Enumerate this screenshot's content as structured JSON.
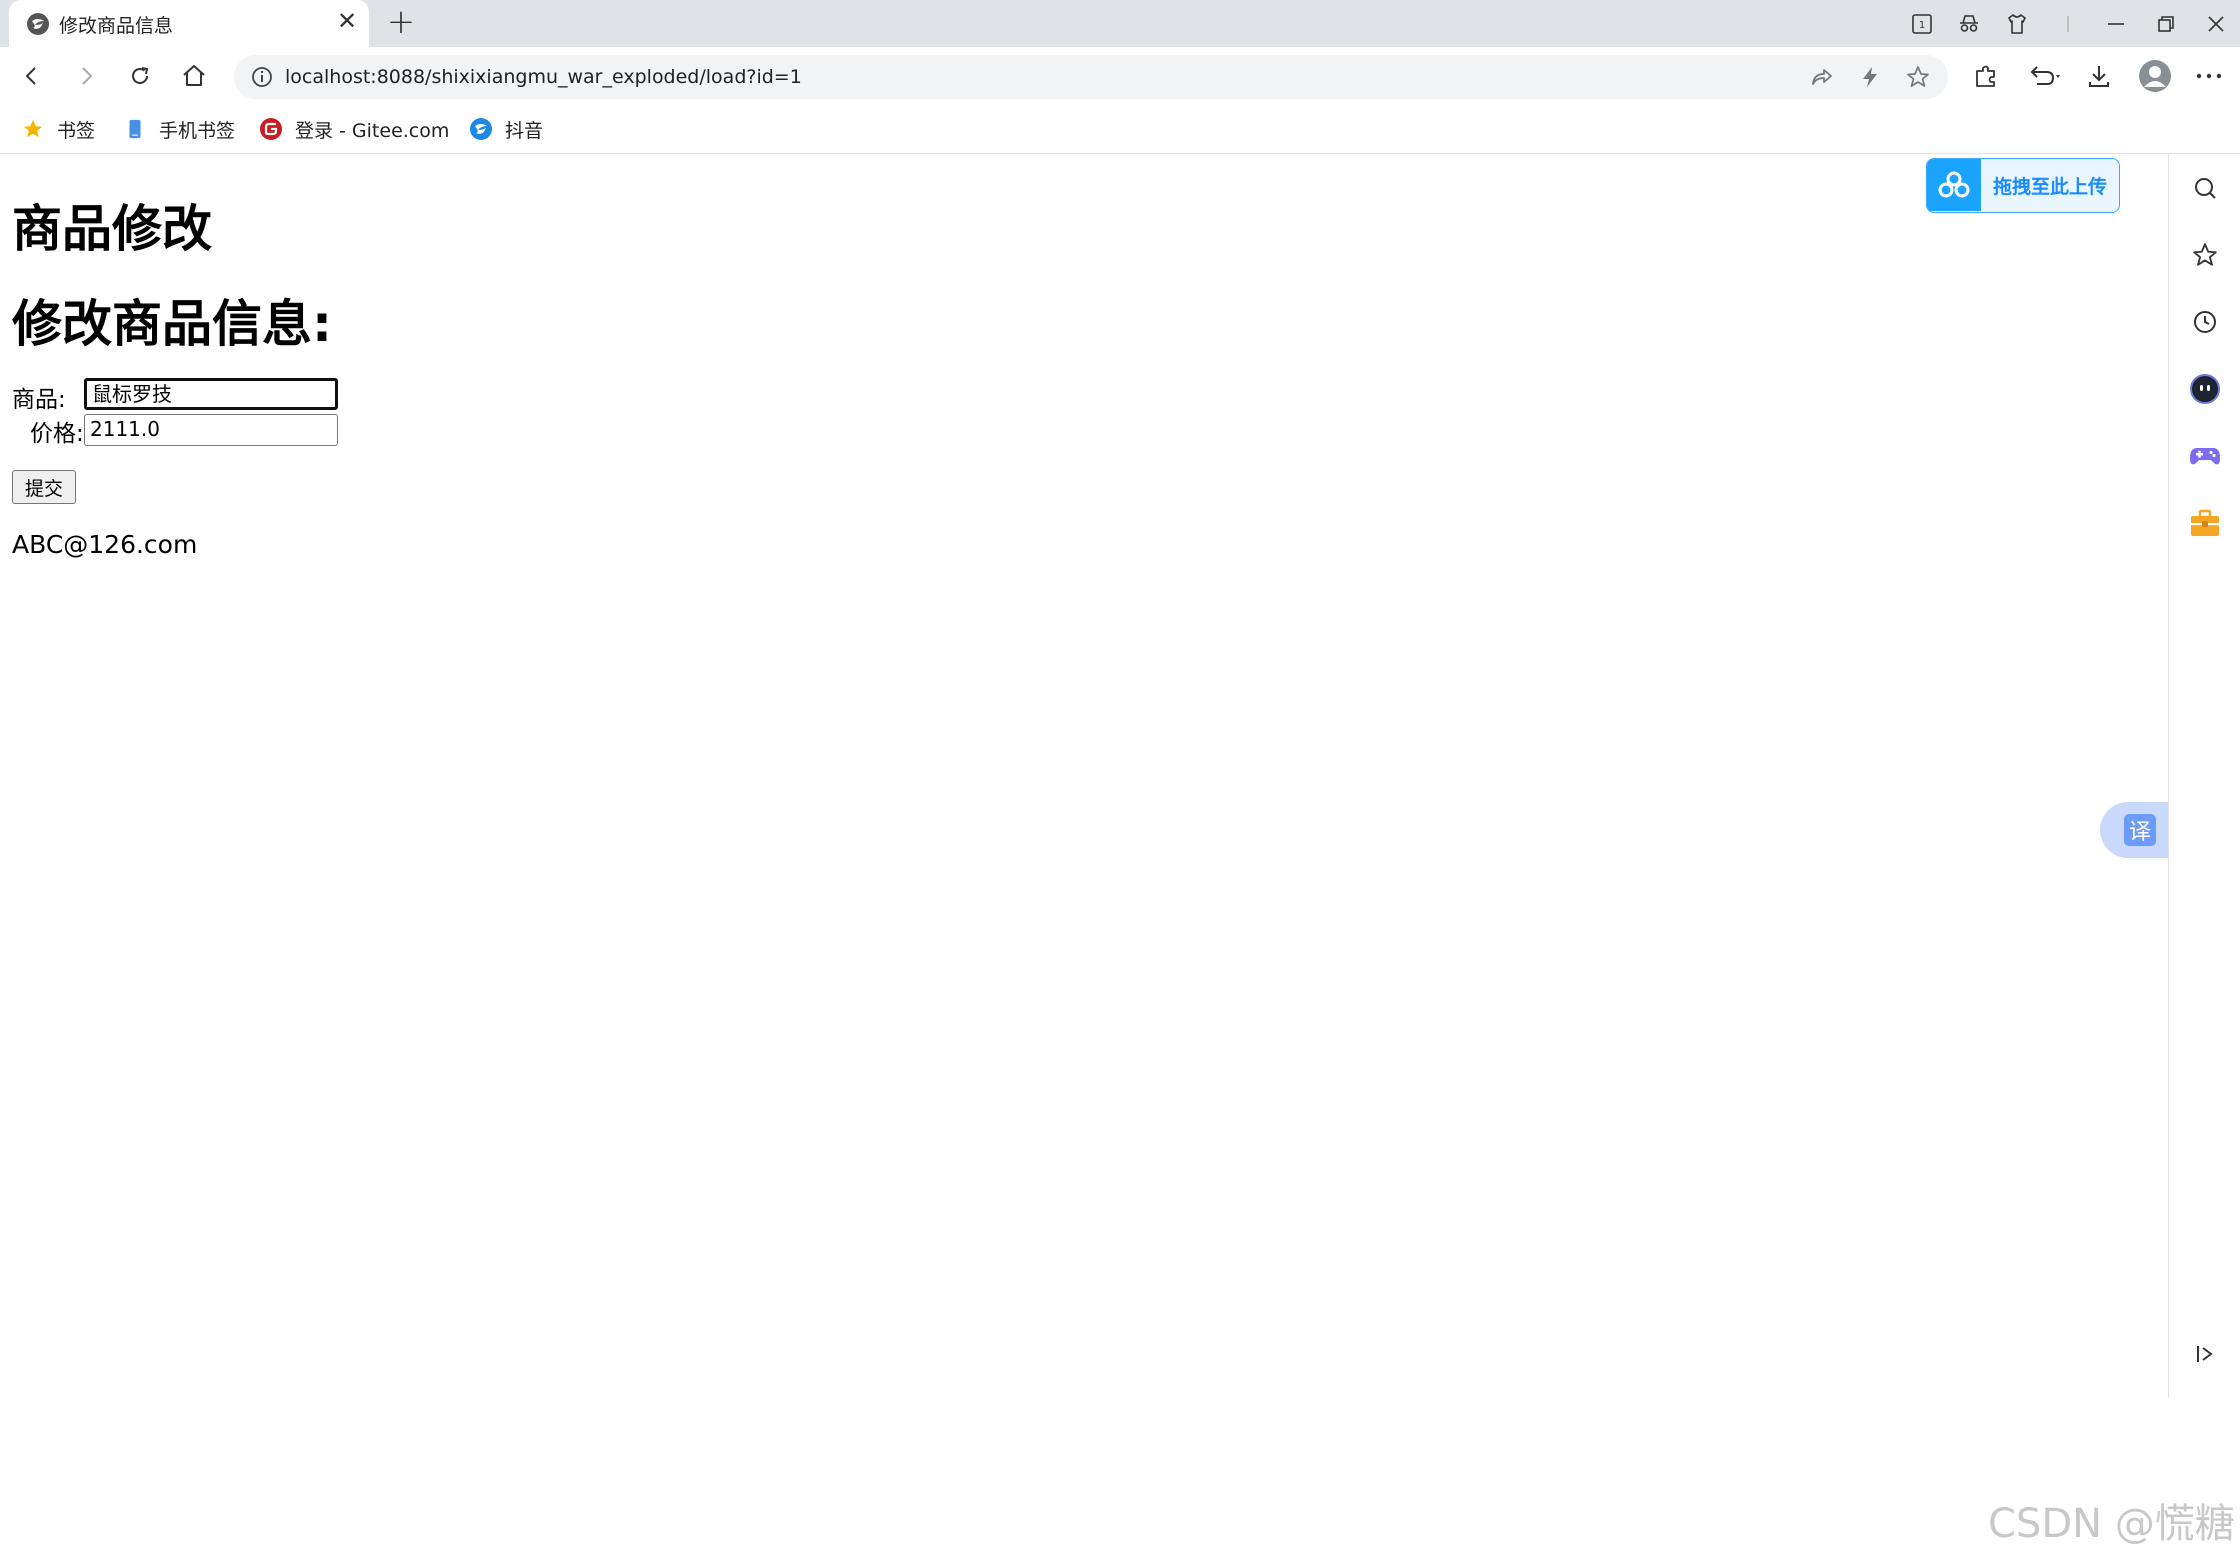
{
  "tab": {
    "title": "修改商品信息",
    "close": "✕",
    "new": "+"
  },
  "address_bar": {
    "url": "localhost:8088/shixixiangmu_war_exploded/load?id=1"
  },
  "bookmarks": [
    {
      "label": "书签",
      "icon": "star-icon"
    },
    {
      "label": "手机书签",
      "icon": "phone-icon"
    },
    {
      "label": "登录 - Gitee.com",
      "icon": "gitee-icon"
    },
    {
      "label": "抖音",
      "icon": "browser-logo-icon"
    }
  ],
  "page": {
    "heading1": "商品修改",
    "heading2": "修改商品信息:",
    "product_label": "商品:",
    "product_value": "鼠标罗技",
    "price_label": "价格:",
    "price_value": "2111.0",
    "submit_label": "提交",
    "email": "ABC@126.com"
  },
  "upload_widget": {
    "label": "拖拽至此上传"
  },
  "translate_widget": {
    "label": "译"
  },
  "watermark": "CSDN @慌糖",
  "colors": {
    "tab_strip": "#dfe3e8",
    "omnibox": "#f1f3f4",
    "upload_accent": "#1aa3ff",
    "translate_accent": "#6c9cf5"
  }
}
